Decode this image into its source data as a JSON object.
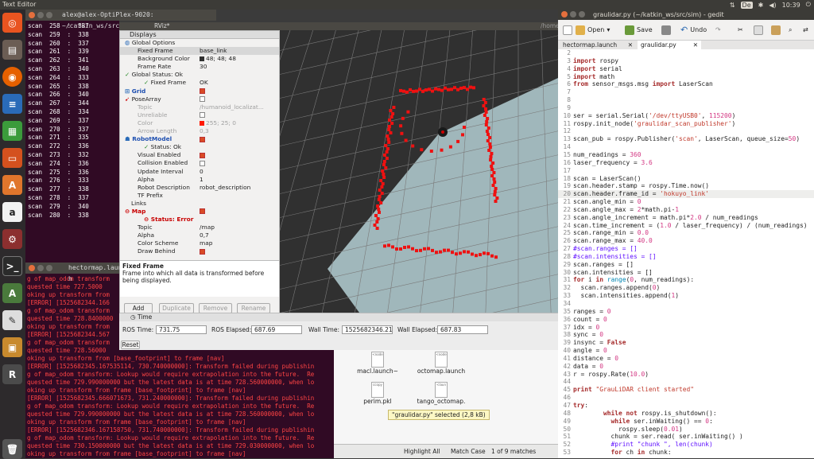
{
  "topbar": {
    "title": "Text Editor",
    "keyboard": "De",
    "time": "10:39"
  },
  "launcher": {
    "items": [
      "dash-icon",
      "files-icon",
      "firefox-icon",
      "writer-icon",
      "calc-icon",
      "impress-icon",
      "software-center-icon",
      "amazon-icon",
      "settings-icon",
      "terminal-icon",
      "a-icon",
      "text-editor-icon",
      "box-icon",
      "rviz-icon",
      "trash-icon"
    ]
  },
  "terminal1": {
    "title": "alex@alex-OptiPlex-9020: ~/catkin_ws/src/sim",
    "lines": [
      {
        "k": "scan",
        "n": "258",
        "v": "337"
      },
      {
        "k": "scan",
        "n": "259",
        "v": "338"
      },
      {
        "k": "scan",
        "n": "260",
        "v": "337"
      },
      {
        "k": "scan",
        "n": "261",
        "v": "339"
      },
      {
        "k": "scan",
        "n": "262",
        "v": "341"
      },
      {
        "k": "scan",
        "n": "263",
        "v": "340"
      },
      {
        "k": "scan",
        "n": "264",
        "v": "333"
      },
      {
        "k": "scan",
        "n": "265",
        "v": "338"
      },
      {
        "k": "scan",
        "n": "266",
        "v": "340"
      },
      {
        "k": "scan",
        "n": "267",
        "v": "344"
      },
      {
        "k": "scan",
        "n": "268",
        "v": "334"
      },
      {
        "k": "scan",
        "n": "269",
        "v": "337"
      },
      {
        "k": "scan",
        "n": "270",
        "v": "337"
      },
      {
        "k": "scan",
        "n": "271",
        "v": "335"
      },
      {
        "k": "scan",
        "n": "272",
        "v": "336"
      },
      {
        "k": "scan",
        "n": "273",
        "v": "332"
      },
      {
        "k": "scan",
        "n": "274",
        "v": "336"
      },
      {
        "k": "scan",
        "n": "275",
        "v": "336"
      },
      {
        "k": "scan",
        "n": "276",
        "v": "333"
      },
      {
        "k": "scan",
        "n": "277",
        "v": "338"
      },
      {
        "k": "scan",
        "n": "278",
        "v": "337"
      },
      {
        "k": "scan",
        "n": "279",
        "v": "340"
      },
      {
        "k": "scan",
        "n": "280",
        "v": "338"
      }
    ]
  },
  "terminal2": {
    "title": "hectormap.launch h",
    "lines": [
      "g of map_odom transform",
      "quested time 727.5000",
      "oking up transform from",
      "[ERROR] [1525682344.166",
      "g of map_odom transform",
      "quested time 728.8400000",
      "oking up transform from",
      "[ERROR] [1525682344.567",
      "g of map_odom transform",
      "quested time 728.56000",
      "oking up transform from [base_footprint] to frame [nav]",
      "[ERROR] [1525682345.167535114, 730.740000000]: Transform failed during publishin",
      "g of map_odom transform: Lookup would require extrapolation into the future.  Re",
      "quested time 729.990000000 but the latest data is at time 728.560000000, when lo",
      "oking up transform from frame [base_footprint] to frame [nav]",
      "[ERROR] [1525682345.666071673, 731.240000000]: Transform failed during publishin",
      "g of map_odom transform: Lookup would require extrapolation into the future.  Re",
      "quested time 729.990000000 but the latest data is at time 728.560000000, when lo",
      "oking up transform from frame [base_footprint] to frame [nav]",
      "[ERROR] [1525682346.167158750, 731.740000000]: Transform failed during publishin",
      "g of map_odom transform: Lookup would require extrapolation into the future.  Re",
      "quested time 730.150000000 but the latest data is at time 729.030000000, when lo",
      "oking up transform from frame [base_footprint] to frame [nav]"
    ]
  },
  "rviz": {
    "title": "RViz*",
    "hidden_title": "/home",
    "panel_title": "Displays",
    "rows": [
      {
        "k": "Global Options",
        "v": "",
        "indent": 6,
        "cls": "",
        "icon": "globe"
      },
      {
        "k": "Fixed Frame",
        "v": "base_link",
        "indent": 22,
        "cls": "sel"
      },
      {
        "k": "Background Color",
        "v": "48; 48; 48",
        "indent": 22,
        "cls": "",
        "sw": "#303030"
      },
      {
        "k": "Frame Rate",
        "v": "30",
        "indent": 22,
        "cls": ""
      },
      {
        "k": "Global Status: Ok",
        "v": "",
        "indent": 6,
        "cls": "",
        "icon": "check"
      },
      {
        "k": "Fixed Frame",
        "v": "OK",
        "indent": 30,
        "cls": "",
        "icon": "check"
      },
      {
        "k": "Grid",
        "v": "",
        "indent": 6,
        "cls": "blue",
        "icon": "grid",
        "chk": true
      },
      {
        "k": "PoseArray",
        "v": "",
        "indent": 6,
        "cls": "",
        "icon": "arrow",
        "chk": false
      },
      {
        "k": "Topic",
        "v": "/humanoid_localizat...",
        "indent": 22,
        "cls": "gray"
      },
      {
        "k": "Unreliable",
        "v": "",
        "indent": 22,
        "cls": "gray",
        "chk": false
      },
      {
        "k": "Color",
        "v": "255; 25; 0",
        "indent": 22,
        "cls": "gray",
        "sw": "#ff1900"
      },
      {
        "k": "Arrow Length",
        "v": "0,3",
        "indent": 22,
        "cls": "gray"
      },
      {
        "k": "RobotModel",
        "v": "",
        "indent": 6,
        "cls": "blue",
        "icon": "robot",
        "chk": true
      },
      {
        "k": "Status: Ok",
        "v": "",
        "indent": 30,
        "cls": "",
        "icon": "check"
      },
      {
        "k": "Visual Enabled",
        "v": "",
        "indent": 22,
        "cls": "",
        "chk": true
      },
      {
        "k": "Collision Enabled",
        "v": "",
        "indent": 22,
        "cls": "",
        "chk": false
      },
      {
        "k": "Update Interval",
        "v": "0",
        "indent": 22,
        "cls": ""
      },
      {
        "k": "Alpha",
        "v": "1",
        "indent": 22,
        "cls": ""
      },
      {
        "k": "Robot Description",
        "v": "robot_description",
        "indent": 22,
        "cls": ""
      },
      {
        "k": "TF Prefix",
        "v": "",
        "indent": 22,
        "cls": ""
      },
      {
        "k": "Links",
        "v": "",
        "indent": 14,
        "cls": ""
      },
      {
        "k": "Map",
        "v": "",
        "indent": 6,
        "cls": "red",
        "icon": "error",
        "chk": true
      },
      {
        "k": "Status: Error",
        "v": "",
        "indent": 30,
        "cls": "red",
        "icon": "error"
      },
      {
        "k": "Topic",
        "v": "/map",
        "indent": 22,
        "cls": ""
      },
      {
        "k": "Alpha",
        "v": "0,7",
        "indent": 22,
        "cls": ""
      },
      {
        "k": "Color Scheme",
        "v": "map",
        "indent": 22,
        "cls": ""
      },
      {
        "k": "Draw Behind",
        "v": "",
        "indent": 22,
        "cls": "",
        "chk": true
      }
    ],
    "desc_title": "Fixed Frame",
    "desc_text": "Frame into which all data is transformed before being displayed.",
    "buttons": [
      "Add",
      "Duplicate",
      "Remove",
      "Rename"
    ],
    "time_title": "Time",
    "ros_time_label": "ROS Time:",
    "ros_time": "731.75",
    "ros_elapsed_label": "ROS Elapsed:",
    "ros_elapsed": "687.69",
    "wall_time_label": "Wall Time:",
    "wall_time": "1525682346.21",
    "wall_elapsed_label": "Wall Elapsed:",
    "wall_elapsed": "687.83",
    "reset": "Reset"
  },
  "nautilus": {
    "files": [
      {
        "name": "macl.launch~",
        "icon": "<node"
      },
      {
        "name": "octomap.launch",
        "icon": "<node"
      },
      {
        "name": "perim.pkl",
        "icon": "ccopy"
      },
      {
        "name": "tango_octomap.",
        "icon": "<laun"
      }
    ],
    "status": "\"graulidar.py\" selected (2,8 kB)",
    "search_bar": {
      "highlight": "Highlight All",
      "match_case": "Match Case",
      "matches": "1 of 9 matches"
    }
  },
  "gedit": {
    "title": "graulidar.py (~/katkin_ws/src/sim) - gedit",
    "open": "Open",
    "save": "Save",
    "undo": "Undo",
    "tabs": [
      "hectormap.launch",
      "graulidar.py"
    ],
    "lines": [
      {
        "n": "2",
        "t": ""
      },
      {
        "n": "3",
        "t": "import rospy"
      },
      {
        "n": "4",
        "t": "import serial"
      },
      {
        "n": "5",
        "t": "import math"
      },
      {
        "n": "6",
        "t": "from sensor_msgs.msg import LaserScan"
      },
      {
        "n": "7",
        "t": ""
      },
      {
        "n": "8",
        "t": ""
      },
      {
        "n": "9",
        "t": ""
      },
      {
        "n": "10",
        "t": "ser = serial.Serial('/dev/ttyUSB0', 115200)"
      },
      {
        "n": "11",
        "t": "rospy.init_node('graulidar_scan_publisher')"
      },
      {
        "n": "12",
        "t": ""
      },
      {
        "n": "13",
        "t": "scan_pub = rospy.Publisher('scan', LaserScan, queue_size=50)"
      },
      {
        "n": "14",
        "t": ""
      },
      {
        "n": "15",
        "t": "num_readings = 360"
      },
      {
        "n": "16",
        "t": "laser_frequency = 3.6"
      },
      {
        "n": "17",
        "t": ""
      },
      {
        "n": "18",
        "t": "scan = LaserScan()"
      },
      {
        "n": "19",
        "t": "scan.header.stamp = rospy.Time.now()"
      },
      {
        "n": "20",
        "t": "scan.header.frame_id = 'hokuyo_link'"
      },
      {
        "n": "21",
        "t": "scan.angle_min = 0"
      },
      {
        "n": "22",
        "t": "scan.angle_max = 2*math.pi-1"
      },
      {
        "n": "23",
        "t": "scan.angle_increment = math.pi*2.0 / num_readings"
      },
      {
        "n": "24",
        "t": "scan.time_increment = (1.0 / laser_frequency) / (num_readings)"
      },
      {
        "n": "25",
        "t": "scan.range_min = 0.0"
      },
      {
        "n": "26",
        "t": "scan.range_max = 40.0"
      },
      {
        "n": "27",
        "t": "#scan.ranges = []"
      },
      {
        "n": "28",
        "t": "#scan.intensities = []"
      },
      {
        "n": "29",
        "t": "scan.ranges = []"
      },
      {
        "n": "30",
        "t": "scan.intensities = []"
      },
      {
        "n": "31",
        "t": "for i in range(0, num_readings):"
      },
      {
        "n": "32",
        "t": "  scan.ranges.append(0)"
      },
      {
        "n": "33",
        "t": "  scan.intensities.append(1)"
      },
      {
        "n": "34",
        "t": ""
      },
      {
        "n": "35",
        "t": "ranges = 0"
      },
      {
        "n": "36",
        "t": "count = 0"
      },
      {
        "n": "37",
        "t": "idx = 0"
      },
      {
        "n": "38",
        "t": "sync = 0"
      },
      {
        "n": "39",
        "t": "insync = False"
      },
      {
        "n": "40",
        "t": "angle = 0"
      },
      {
        "n": "41",
        "t": "distance = 0"
      },
      {
        "n": "42",
        "t": "data = 0"
      },
      {
        "n": "43",
        "t": "r = rospy.Rate(10.0)"
      },
      {
        "n": "44",
        "t": ""
      },
      {
        "n": "45",
        "t": "print \"GrauLiDAR client started\""
      },
      {
        "n": "46",
        "t": ""
      },
      {
        "n": "47",
        "t": "try:"
      },
      {
        "n": "48",
        "t": "        while not rospy.is_shutdown():"
      },
      {
        "n": "49",
        "t": "          while ser.inWaiting() == 0:"
      },
      {
        "n": "50",
        "t": "            rospy.sleep(0.01)"
      },
      {
        "n": "51",
        "t": "          chunk = ser.read( ser.inWaiting() )"
      },
      {
        "n": "52",
        "t": "          #print \"chunk \", len(chunk)"
      },
      {
        "n": "53",
        "t": "          for ch in chunk:"
      }
    ]
  },
  "colors": {
    "terminal_bg": "#300a24",
    "scan_points": "#ee1111",
    "grid_plane": "#b4cfd4",
    "viewport_bg": "#303030"
  }
}
